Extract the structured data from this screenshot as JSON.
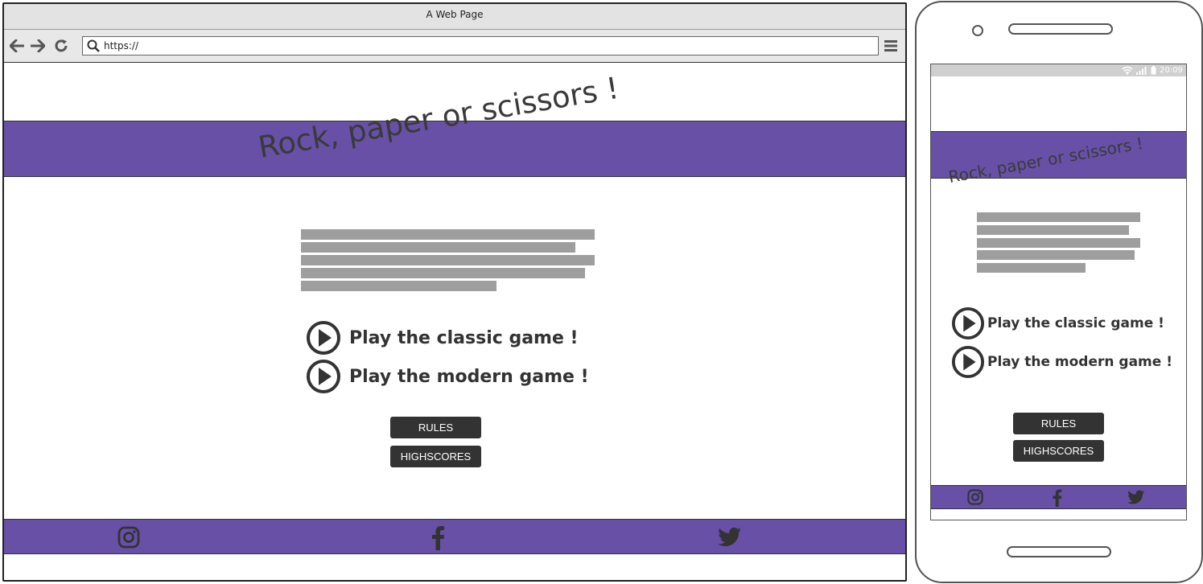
{
  "browser": {
    "window_title": "A Web Page",
    "url": "https://",
    "icons": {
      "back": "arrow-left-icon",
      "forward": "arrow-right-icon",
      "reload": "reload-icon",
      "search": "search-icon",
      "menu": "hamburger-menu-icon"
    }
  },
  "site": {
    "title": "Rock, paper or scissors !",
    "play_classic": "Play the classic game !",
    "play_modern": "Play the modern game !",
    "rules_button": "RULES",
    "highscores_button": "HIGHSCORES",
    "social_icons": [
      "instagram-icon",
      "facebook-icon",
      "twitter-icon"
    ]
  },
  "phone": {
    "status_time": "20:09"
  },
  "colors": {
    "accent": "#6750a6",
    "dark": "#333333",
    "placeholder_text": "#9e9e9e"
  }
}
